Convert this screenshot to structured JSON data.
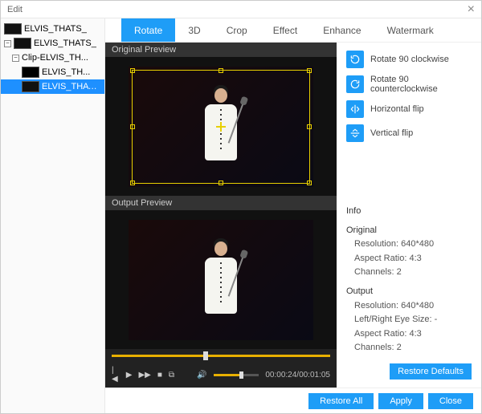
{
  "window": {
    "title": "Edit"
  },
  "tree": {
    "items": [
      {
        "label": "ELVIS_THATS_",
        "level": 0,
        "thumb": "video"
      },
      {
        "label": "ELVIS_THATS_",
        "level": 0,
        "thumb": "video",
        "expanded": true
      },
      {
        "label": "Clip-ELVIS_TH...",
        "level": 1,
        "thumb": "none",
        "expanded": true
      },
      {
        "label": "ELVIS_TH...",
        "level": 2,
        "thumb": "blank"
      },
      {
        "label": "ELVIS_THATS_",
        "level": 2,
        "thumb": "video",
        "selected": true
      }
    ]
  },
  "tabs": [
    "Rotate",
    "3D",
    "Crop",
    "Effect",
    "Enhance",
    "Watermark"
  ],
  "active_tab": 0,
  "previews": {
    "original_label": "Original Preview",
    "output_label": "Output Preview"
  },
  "player": {
    "time": "00:00:24/00:01:05",
    "seek_pct": 42,
    "volume_pct": 60
  },
  "rotate_options": [
    {
      "label": "Rotate 90 clockwise",
      "icon": "rotate-cw"
    },
    {
      "label": "Rotate 90 counterclockwise",
      "icon": "rotate-ccw"
    },
    {
      "label": "Horizontal flip",
      "icon": "flip-h"
    },
    {
      "label": "Vertical flip",
      "icon": "flip-v"
    }
  ],
  "info": {
    "title": "Info",
    "original": {
      "header": "Original",
      "resolution": "Resolution: 640*480",
      "aspect": "Aspect Ratio: 4:3",
      "channels": "Channels: 2"
    },
    "output": {
      "header": "Output",
      "resolution": "Resolution: 640*480",
      "eye": "Left/Right Eye Size: -",
      "aspect": "Aspect Ratio: 4:3",
      "channels": "Channels: 2"
    }
  },
  "buttons": {
    "restore_defaults": "Restore Defaults",
    "restore_all": "Restore All",
    "apply": "Apply",
    "close": "Close"
  }
}
